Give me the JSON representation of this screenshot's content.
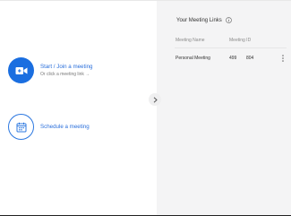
{
  "home": {
    "start_join": {
      "title": "Start / Join a meeting",
      "subtitle": "Or click a meeting link →",
      "icon": "video-camera-plus-icon"
    },
    "schedule": {
      "title": "Schedule a meeting",
      "icon": "calendar-icon"
    },
    "expand_icon": "chevron-right-icon"
  },
  "meeting_links": {
    "title": "Your Meeting Links",
    "title_icon": "info-icon",
    "columns": [
      "Meeting Name",
      "Meeting ID"
    ],
    "rows": [
      {
        "name": "Personal Meeting",
        "id_part1": "499",
        "id_part2": "804"
      }
    ],
    "row_menu_icon": "more-vertical-icon"
  },
  "colors": {
    "accent": "#1a6ee0",
    "link_text": "#2a6fdb",
    "panel_bg": "#f4f4f5"
  }
}
